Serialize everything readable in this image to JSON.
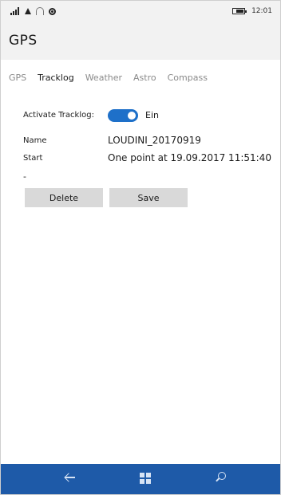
{
  "status_bar": {
    "time": "12:01"
  },
  "header": {
    "title": "GPS"
  },
  "tabs": [
    {
      "label": "GPS",
      "active": false
    },
    {
      "label": "Tracklog",
      "active": true
    },
    {
      "label": "Weather",
      "active": false
    },
    {
      "label": "Astro",
      "active": false
    },
    {
      "label": "Compass",
      "active": false
    }
  ],
  "tracklog": {
    "activate_label": "Activate Tracklog:",
    "activate_state": "Ein",
    "activate_on": true,
    "name_label": "Name",
    "name_value": "LOUDINI_20170919",
    "start_label": "Start",
    "start_value": "One point at 19.09.2017 11:51:40",
    "extra": "-"
  },
  "buttons": {
    "delete": "Delete",
    "save": "Save"
  },
  "colors": {
    "accent": "#1e70c9",
    "navbar": "#1e5aa8",
    "header_bg": "#f2f2f2",
    "button_bg": "#d9d9d9"
  },
  "icons": {
    "status": [
      "signal-icon",
      "network-icon",
      "wifi-icon",
      "location-icon",
      "battery-icon"
    ],
    "nav": [
      "back-arrow-icon",
      "windows-icon",
      "search-icon"
    ]
  }
}
